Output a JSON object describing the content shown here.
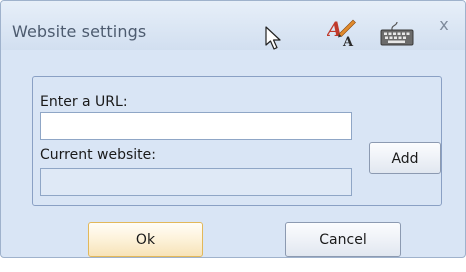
{
  "dialog": {
    "title": "Website settings",
    "close_glyph": "x",
    "icons": [
      "mouse-pointer-icon",
      "font-style-icon",
      "keyboard-icon"
    ]
  },
  "form": {
    "url_label": "Enter a URL:",
    "url_value": "",
    "current_label": "Current website:",
    "current_value": "",
    "add_label": "Add"
  },
  "actions": {
    "ok_label": "Ok",
    "cancel_label": "Cancel"
  },
  "colors": {
    "background": "#d9e5f5",
    "group_border": "#8aa0c4",
    "ok_border": "#e2b85a",
    "title_text": "#4d5b6f"
  }
}
